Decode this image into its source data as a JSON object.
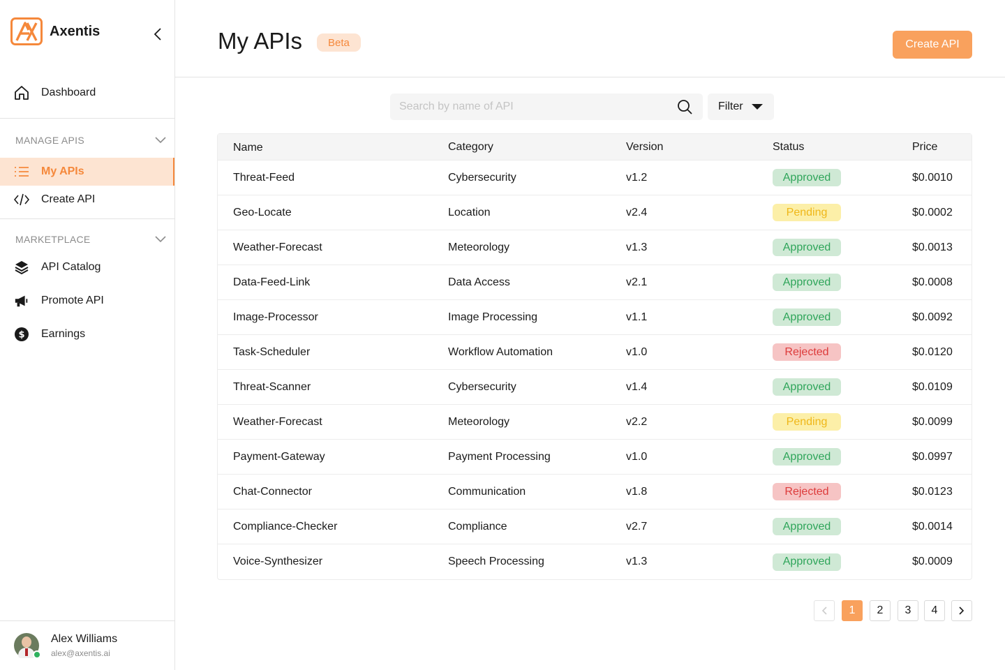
{
  "app": {
    "name": "Axentis"
  },
  "sidebar": {
    "dashboard_label": "Dashboard",
    "manage_section": "MANAGE APIS",
    "my_apis_label": "My APIs",
    "create_api_label": "Create API",
    "marketplace_section": "MARKETPLACE",
    "api_catalog_label": "API Catalog",
    "promote_api_label": "Promote API",
    "earnings_label": "Earnings"
  },
  "user": {
    "name": "Alex Williams",
    "email": "alex@axentis.ai"
  },
  "header": {
    "title": "My APIs",
    "badge": "Beta",
    "create_button": "Create API"
  },
  "toolbar": {
    "search_placeholder": "Search by name of API",
    "filter_label": "Filter"
  },
  "colors": {
    "accent": "#f5883b",
    "button": "#f9a15d",
    "approved": "#2fa55a",
    "pending": "#efb719",
    "rejected": "#dd3b3b"
  },
  "table": {
    "headers": {
      "name": "Name",
      "category": "Category",
      "version": "Version",
      "status": "Status",
      "price": "Price"
    },
    "rows": [
      {
        "name": "Threat-Feed",
        "category": "Cybersecurity",
        "version": "v1.2",
        "status": "Approved",
        "price": "$0.0010"
      },
      {
        "name": "Geo-Locate",
        "category": "Location",
        "version": "v2.4",
        "status": "Pending",
        "price": "$0.0002"
      },
      {
        "name": "Weather-Forecast",
        "category": "Meteorology",
        "version": "v1.3",
        "status": "Approved",
        "price": "$0.0013"
      },
      {
        "name": "Data-Feed-Link",
        "category": "Data Access",
        "version": "v2.1",
        "status": "Approved",
        "price": "$0.0008"
      },
      {
        "name": "Image-Processor",
        "category": "Image Processing",
        "version": "v1.1",
        "status": "Approved",
        "price": "$0.0092"
      },
      {
        "name": "Task-Scheduler",
        "category": "Workflow Automation",
        "version": "v1.0",
        "status": "Rejected",
        "price": "$0.0120"
      },
      {
        "name": "Threat-Scanner",
        "category": "Cybersecurity",
        "version": "v1.4",
        "status": "Approved",
        "price": "$0.0109"
      },
      {
        "name": "Weather-Forecast",
        "category": "Meteorology",
        "version": "v2.2",
        "status": "Pending",
        "price": "$0.0099"
      },
      {
        "name": "Payment-Gateway",
        "category": "Payment Processing",
        "version": "v1.0",
        "status": "Approved",
        "price": "$0.0997"
      },
      {
        "name": "Chat-Connector",
        "category": "Communication",
        "version": "v1.8",
        "status": "Rejected",
        "price": "$0.0123"
      },
      {
        "name": "Compliance-Checker",
        "category": "Compliance",
        "version": "v2.7",
        "status": "Approved",
        "price": "$0.0014"
      },
      {
        "name": "Voice-Synthesizer",
        "category": "Speech Processing",
        "version": "v1.3",
        "status": "Approved",
        "price": "$0.0009"
      }
    ]
  },
  "pagination": {
    "pages": [
      "1",
      "2",
      "3",
      "4"
    ],
    "current": "1"
  }
}
